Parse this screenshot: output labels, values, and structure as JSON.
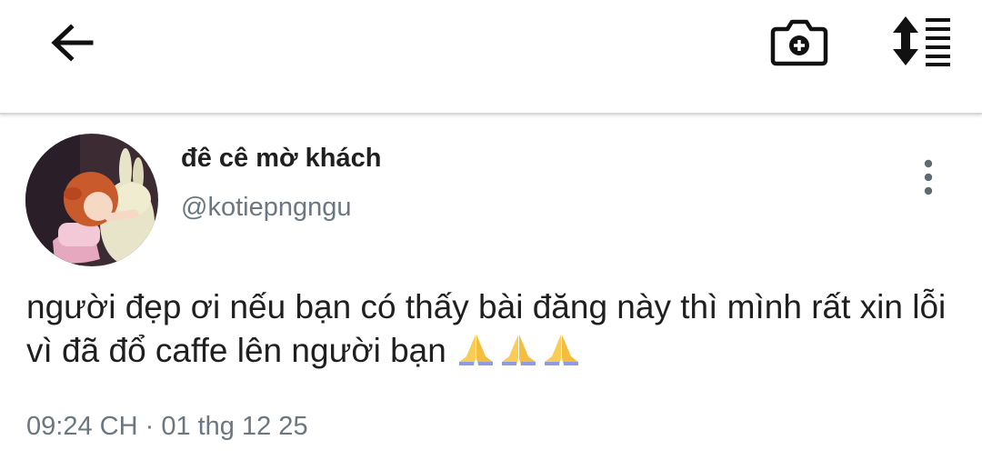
{
  "icons": {
    "back": "arrow-left-icon",
    "camera": "camera-plus-icon",
    "reorder": "sort-list-icon",
    "more": "more-vertical-icon",
    "emoji": "folded-hands-emoji"
  },
  "tweet": {
    "display_name": "đê cê mờ khách",
    "handle": "@kotiepngngu",
    "text": "người đẹp ơi nếu bạn có thấy bài đăng này thì mình rất xin lỗi vì đã đổ caffe lên người bạn",
    "emojis": "🙏🙏🙏",
    "time": "09:24 CH",
    "separator": "·",
    "date": "01 thg 12 25"
  },
  "colors": {
    "text": "#1f1f1f",
    "muted": "#6b7780",
    "divider": "#d9d9d9"
  }
}
